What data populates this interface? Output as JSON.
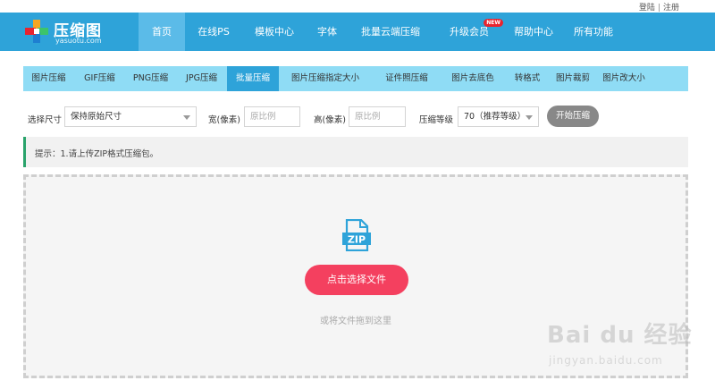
{
  "top_links": {
    "login": "登陆",
    "separator": "|",
    "register": "注册"
  },
  "brand": {
    "title": "压缩图",
    "subtitle": "yasuotu.com"
  },
  "nav": {
    "items": [
      {
        "label": "首页",
        "active": true
      },
      {
        "label": "在线PS"
      },
      {
        "label": "模板中心"
      },
      {
        "label": "字体"
      },
      {
        "label": "批量云端压缩"
      },
      {
        "label": "升级会员",
        "badge": "NEW"
      },
      {
        "label": "帮助中心"
      },
      {
        "label": "所有功能"
      }
    ]
  },
  "tabs": [
    {
      "label": "图片压缩"
    },
    {
      "label": "GIF压缩"
    },
    {
      "label": "PNG压缩"
    },
    {
      "label": "JPG压缩"
    },
    {
      "label": "批量压缩",
      "active": true
    },
    {
      "label": "图片压缩指定大小"
    },
    {
      "label": "证件照压缩"
    },
    {
      "label": "图片去底色"
    },
    {
      "label": "转格式"
    },
    {
      "label": "图片裁剪"
    },
    {
      "label": "图片改大小"
    }
  ],
  "options": {
    "size_label": "选择尺寸",
    "size_value": "保持原始尺寸",
    "width_label": "宽(像素)",
    "width_placeholder": "原比例",
    "height_label": "高(像素)",
    "height_placeholder": "原比例",
    "level_label": "压缩等级",
    "level_value": "70（推荐等级）",
    "start_label": "开始压缩"
  },
  "notice": {
    "text": "提示：1.请上传ZIP格式压缩包。"
  },
  "dropzone": {
    "icon_text": "ZIP",
    "choose_label": "点击选择文件",
    "hint": "或将文件拖到这里"
  },
  "watermark": {
    "text": "Bai du 经验",
    "url": "jingyan.baidu.com"
  },
  "colors": {
    "header": "#2ea3d9",
    "nav_active": "#5bbbe8",
    "tabs_bg": "#8fdcf5",
    "choose_button": "#f4405f",
    "start_button": "#888888",
    "notice_bar": "#2aa36b",
    "new_badge": "#e8242f"
  }
}
